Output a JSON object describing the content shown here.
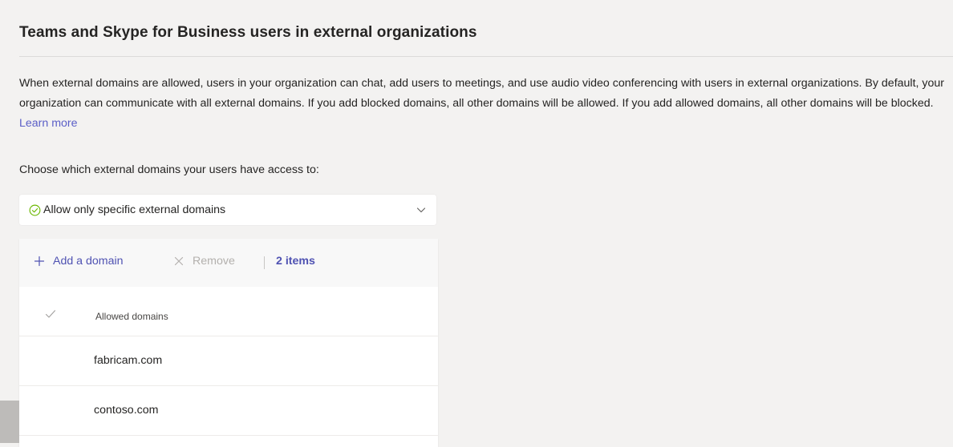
{
  "section": {
    "title": "Teams and Skype for Business users in external organizations",
    "description": "When external domains are allowed, users in your organization can chat, add users to meetings, and use audio video conferencing with users in external organizations. By default, your organization can communicate with all external domains. If you add blocked domains, all other domains will be allowed. If you add allowed domains, all other domains will be blocked.",
    "learn_more": "Learn more"
  },
  "access": {
    "label": "Choose which external domains your users have access to:",
    "selected_option": "Allow only specific external domains",
    "selected_icon": "check-circle-icon",
    "dropdown_icon": "chevron-down-icon"
  },
  "toolbar": {
    "add_label": "Add a domain",
    "add_icon": "plus-icon",
    "remove_label": "Remove",
    "remove_icon": "close-icon",
    "count_label": "2 items"
  },
  "table": {
    "select_all_icon": "checkmark-icon",
    "column_header": "Allowed domains",
    "rows": [
      "fabricam.com",
      "contoso.com"
    ]
  },
  "colors": {
    "accent": "#4f52b2",
    "link": "#5b5fc7",
    "disabled": "#b3b0ad",
    "success": "#6bb700",
    "background": "#f3f2f1"
  }
}
